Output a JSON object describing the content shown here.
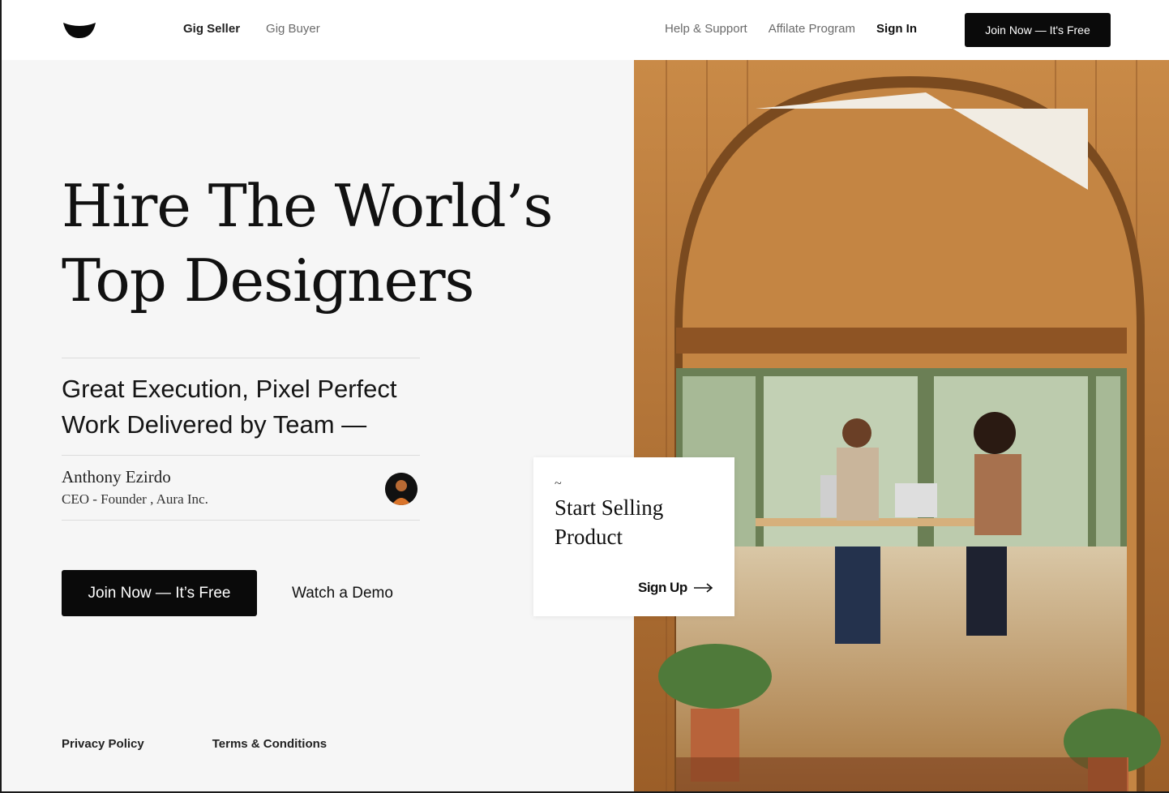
{
  "header": {
    "nav_left": [
      {
        "label": "Gig Seller"
      },
      {
        "label": "Gig Buyer"
      }
    ],
    "nav_right": [
      {
        "label": "Help & Support"
      },
      {
        "label": "Affilate Program"
      },
      {
        "label": "Sign In"
      }
    ],
    "cta_label": "Join Now — It's Free"
  },
  "hero": {
    "title_line1": "Hire The World’s",
    "title_line2": "Top Designers",
    "tagline": "Great Execution, Pixel Perfect Work Delivered by Team —",
    "person_name": "Anthony Ezirdo",
    "person_role": "CEO - Founder , Aura Inc.",
    "primary_cta": "Join Now — It’s Free",
    "secondary_cta": "Watch a Demo"
  },
  "card": {
    "tilde": "~",
    "title": "Start Selling Product",
    "link_label": "Sign Up"
  },
  "footer": {
    "privacy": "Privacy Policy",
    "terms": "Terms & Conditions"
  },
  "colors": {
    "primary": "#0a0a0a",
    "background_left": "#f6f6f6",
    "wood": "#b5773a"
  }
}
